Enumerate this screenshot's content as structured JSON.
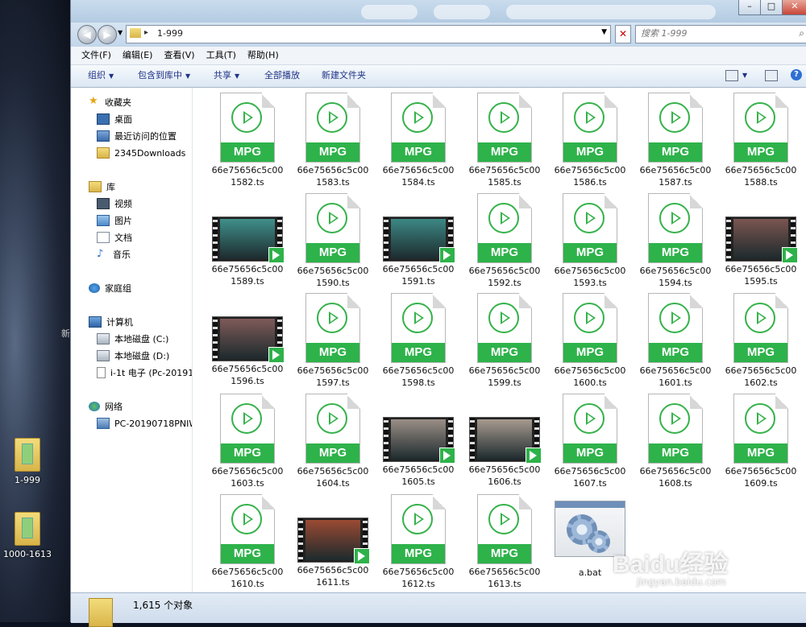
{
  "desktop": {
    "icons": [
      {
        "label": "1-999"
      },
      {
        "label": "1000-1613"
      }
    ],
    "side_text": "新"
  },
  "window": {
    "controls": {
      "minimize": "–",
      "maximize": "□",
      "close": "✕"
    },
    "address": {
      "path": "1-999"
    },
    "search": {
      "placeholder": "搜索 1-999"
    },
    "menu": [
      "文件(F)",
      "编辑(E)",
      "查看(V)",
      "工具(T)",
      "帮助(H)"
    ],
    "commands": {
      "organize": "组织",
      "include_library": "包含到库中",
      "share": "共享",
      "play_all": "全部播放",
      "new_folder": "新建文件夹"
    },
    "sidebar": {
      "favorites": {
        "label": "收藏夹",
        "items": [
          "桌面",
          "最近访问的位置",
          "2345Downloads"
        ]
      },
      "libraries": {
        "label": "库",
        "items": [
          "视频",
          "图片",
          "文档",
          "音乐"
        ]
      },
      "homegroup": "家庭组",
      "computer": {
        "label": "计算机",
        "items": [
          "本地磁盘 (C:)",
          "本地磁盘 (D:)",
          "i-1t 电子 (Pc-20191"
        ]
      },
      "network": {
        "label": "网络",
        "items": [
          "PC-20190718PNIW"
        ]
      }
    },
    "files": [
      {
        "line1": "66e75656c5c00",
        "line2": "1582.ts",
        "type": "mpg"
      },
      {
        "line1": "66e75656c5c00",
        "line2": "1583.ts",
        "type": "mpg"
      },
      {
        "line1": "66e75656c5c00",
        "line2": "1584.ts",
        "type": "mpg"
      },
      {
        "line1": "66e75656c5c00",
        "line2": "1585.ts",
        "type": "mpg"
      },
      {
        "line1": "66e75656c5c00",
        "line2": "1586.ts",
        "type": "mpg"
      },
      {
        "line1": "66e75656c5c00",
        "line2": "1587.ts",
        "type": "mpg"
      },
      {
        "line1": "66e75656c5c00",
        "line2": "1588.ts",
        "type": "mpg"
      },
      {
        "line1": "66e75656c5c00",
        "line2": "1589.ts",
        "type": "thumb",
        "tint": "#3f8f8a"
      },
      {
        "line1": "66e75656c5c00",
        "line2": "1590.ts",
        "type": "mpg"
      },
      {
        "line1": "66e75656c5c00",
        "line2": "1591.ts",
        "type": "thumb",
        "tint": "#3c8884"
      },
      {
        "line1": "66e75656c5c00",
        "line2": "1592.ts",
        "type": "mpg"
      },
      {
        "line1": "66e75656c5c00",
        "line2": "1593.ts",
        "type": "mpg"
      },
      {
        "line1": "66e75656c5c00",
        "line2": "1594.ts",
        "type": "mpg"
      },
      {
        "line1": "66e75656c5c00",
        "line2": "1595.ts",
        "type": "thumb",
        "tint": "#7a5550"
      },
      {
        "line1": "66e75656c5c00",
        "line2": "1596.ts",
        "type": "thumb",
        "tint": "#7e5a58"
      },
      {
        "line1": "66e75656c5c00",
        "line2": "1597.ts",
        "type": "mpg"
      },
      {
        "line1": "66e75656c5c00",
        "line2": "1598.ts",
        "type": "mpg"
      },
      {
        "line1": "66e75656c5c00",
        "line2": "1599.ts",
        "type": "mpg"
      },
      {
        "line1": "66e75656c5c00",
        "line2": "1600.ts",
        "type": "mpg"
      },
      {
        "line1": "66e75656c5c00",
        "line2": "1601.ts",
        "type": "mpg"
      },
      {
        "line1": "66e75656c5c00",
        "line2": "1602.ts",
        "type": "mpg"
      },
      {
        "line1": "66e75656c5c00",
        "line2": "1603.ts",
        "type": "mpg"
      },
      {
        "line1": "66e75656c5c00",
        "line2": "1604.ts",
        "type": "mpg"
      },
      {
        "line1": "66e75656c5c00",
        "line2": "1605.ts",
        "type": "thumb",
        "tint": "#9a8e86"
      },
      {
        "line1": "66e75656c5c00",
        "line2": "1606.ts",
        "type": "thumb",
        "tint": "#a69a8f"
      },
      {
        "line1": "66e75656c5c00",
        "line2": "1607.ts",
        "type": "mpg"
      },
      {
        "line1": "66e75656c5c00",
        "line2": "1608.ts",
        "type": "mpg"
      },
      {
        "line1": "66e75656c5c00",
        "line2": "1609.ts",
        "type": "mpg"
      },
      {
        "line1": "66e75656c5c00",
        "line2": "1610.ts",
        "type": "mpg"
      },
      {
        "line1": "66e75656c5c00",
        "line2": "1611.ts",
        "type": "thumb",
        "tint": "#9a4a33"
      },
      {
        "line1": "66e75656c5c00",
        "line2": "1612.ts",
        "type": "mpg"
      },
      {
        "line1": "66e75656c5c00",
        "line2": "1613.ts",
        "type": "mpg"
      },
      {
        "line1": "a.bat",
        "line2": "",
        "type": "bat"
      }
    ],
    "mpg_badge": "MPG",
    "status": {
      "count": "1,615 个对象"
    }
  },
  "watermark": {
    "brand": "Baidu经验",
    "url": "jingyan.baidu.com"
  },
  "colors": {
    "mpg_green": "#2eb24a",
    "title_gradient": "#c9dced",
    "link_blue": "#1e3287"
  }
}
